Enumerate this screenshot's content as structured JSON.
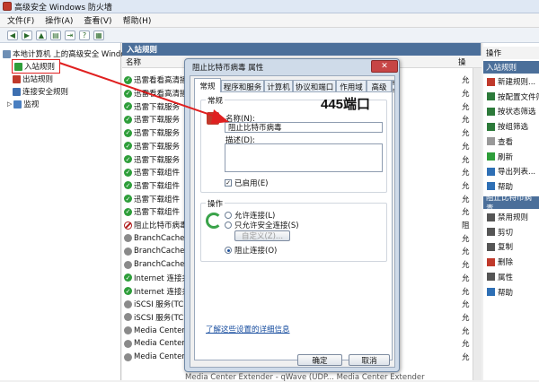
{
  "window": {
    "title": "高级安全 Windows 防火墙"
  },
  "menu": [
    "文件(F)",
    "操作(A)",
    "查看(V)",
    "帮助(H)"
  ],
  "tree": {
    "root": "本地计算机 上的高级安全 Windo",
    "items": [
      "入站规则",
      "出站规则",
      "连接安全规则",
      "监视"
    ]
  },
  "center": {
    "header": "入站规则",
    "column_name": "名称",
    "rules": [
      {
        "label": "迅雷看看高清播",
        "state": "allow"
      },
      {
        "label": "迅雷看看高清播",
        "state": "allow"
      },
      {
        "label": "迅雷下载服务",
        "state": "allow"
      },
      {
        "label": "迅雷下载服务",
        "state": "allow"
      },
      {
        "label": "迅雷下载服务",
        "state": "allow"
      },
      {
        "label": "迅雷下载服务",
        "state": "allow"
      },
      {
        "label": "迅雷下载服务",
        "state": "allow"
      },
      {
        "label": "迅雷下载组件",
        "state": "allow"
      },
      {
        "label": "迅雷下载组件",
        "state": "allow"
      },
      {
        "label": "迅雷下载组件",
        "state": "allow"
      },
      {
        "label": "迅雷下载组件",
        "state": "allow"
      },
      {
        "label": "阻止比特币病毒",
        "state": "block"
      },
      {
        "label": "BranchCache",
        "state": "off"
      },
      {
        "label": "BranchCache",
        "state": "off"
      },
      {
        "label": "BranchCache",
        "state": "off"
      },
      {
        "label": "Internet 连接共",
        "state": "allow"
      },
      {
        "label": "Internet 连接共",
        "state": "allow"
      },
      {
        "label": "iSCSI 服务(TCP",
        "state": "off"
      },
      {
        "label": "iSCSI 服务(TCP",
        "state": "off"
      },
      {
        "label": "Media Center",
        "state": "off"
      },
      {
        "label": "Media Center",
        "state": "off"
      },
      {
        "label": "Media Center",
        "state": "off"
      }
    ],
    "right_col_header": "操",
    "right_col_values": [
      "允",
      "允",
      "允",
      "允",
      "允",
      "允",
      "允",
      "允",
      "允",
      "允",
      "允",
      "阻",
      "允",
      "允",
      "允",
      "允",
      "允",
      "允",
      "允",
      "允",
      "允",
      "允"
    ],
    "bottom_text": "Media Center Extender - qWave (UDP... Media Center Extender"
  },
  "actions": {
    "header": "操作",
    "section1": "入站规则",
    "items1": [
      {
        "label": "新建规则...",
        "icon": "new-rule-icon",
        "color": "#c0392b"
      },
      {
        "label": "按配置文件筛选",
        "icon": "filter-icon",
        "color": "#2c7a3a"
      },
      {
        "label": "按状态筛选",
        "icon": "filter-icon",
        "color": "#2c7a3a"
      },
      {
        "label": "按组筛选",
        "icon": "filter-icon",
        "color": "#2c7a3a"
      },
      {
        "label": "查看",
        "icon": "view-icon",
        "color": "#999999"
      },
      {
        "label": "刷新",
        "icon": "refresh-icon",
        "color": "#2e9e3a"
      },
      {
        "label": "导出列表...",
        "icon": "export-icon",
        "color": "#2e6fb5"
      },
      {
        "label": "帮助",
        "icon": "help-icon",
        "color": "#2e6fb5"
      }
    ],
    "section2": "阻止比特币病毒",
    "items2": [
      {
        "label": "禁用规则",
        "icon": "disable-icon",
        "color": "#555555"
      },
      {
        "label": "剪切",
        "icon": "cut-icon",
        "color": "#555555"
      },
      {
        "label": "复制",
        "icon": "copy-icon",
        "color": "#555555"
      },
      {
        "label": "删除",
        "icon": "delete-icon",
        "color": "#c0392b"
      },
      {
        "label": "属性",
        "icon": "properties-icon",
        "color": "#555555"
      },
      {
        "label": "帮助",
        "icon": "help-icon",
        "color": "#2e6fb5"
      }
    ]
  },
  "dialog": {
    "title": "阻止比特币病毒 属性",
    "tabs": [
      "常规",
      "程序和服务",
      "计算机",
      "协议和端口",
      "作用域",
      "高级",
      "用户"
    ],
    "general_label": "常规",
    "annotation": "445端口",
    "name_label": "名称(N):",
    "name_value": "阻止比特币病毒",
    "desc_label": "描述(D):",
    "enabled_label": "已启用(E)",
    "action_label": "操作",
    "options": [
      "允许连接(L)",
      "只允许安全连接(S)",
      "阻止连接(O)"
    ],
    "custom_button": "自定义(Z)...",
    "link": "了解这些设置的详细信息",
    "ok": "确定",
    "cancel": "取消"
  }
}
